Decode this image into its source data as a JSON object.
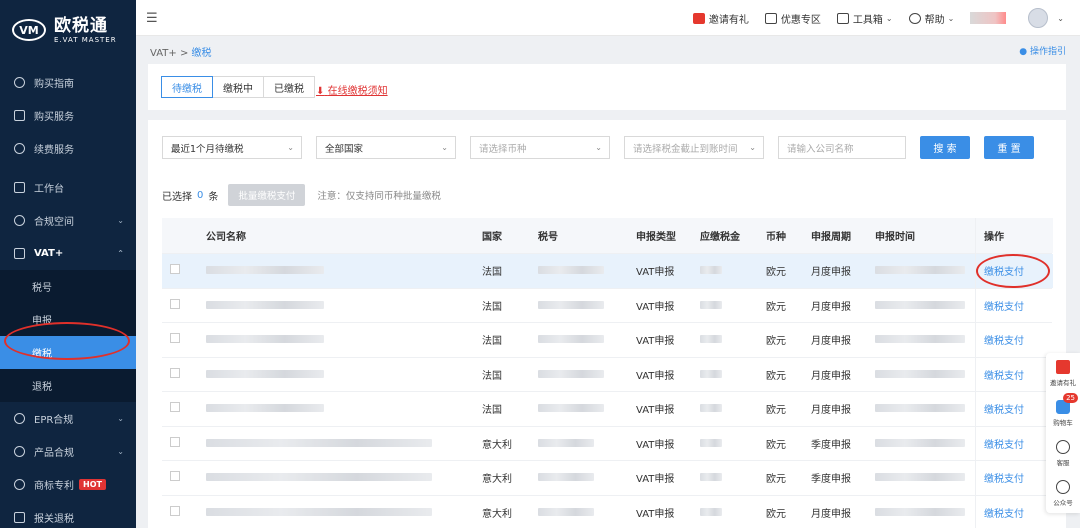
{
  "logo": {
    "cn": "欧税通",
    "en": "E.VAT MASTER",
    "mark": "VM"
  },
  "sidebar": {
    "items": [
      {
        "label": "购买指南",
        "icon": "compass-icon"
      },
      {
        "label": "购买服务",
        "icon": "bag-icon"
      },
      {
        "label": "续费服务",
        "icon": "refresh-icon"
      },
      {
        "label": "工作台",
        "icon": "dashboard-icon"
      },
      {
        "label": "合规空间",
        "icon": "gear-icon"
      },
      {
        "label": "VAT+",
        "icon": "briefcase-icon"
      },
      {
        "label": "EPR合规",
        "icon": "leaf-icon"
      },
      {
        "label": "产品合规",
        "icon": "shield-icon"
      },
      {
        "label": "商标专利",
        "icon": "badge-icon",
        "badge": "HOT"
      },
      {
        "label": "报关退税",
        "icon": "document-icon"
      }
    ],
    "vat_sub": [
      {
        "label": "税号"
      },
      {
        "label": "申报"
      },
      {
        "label": "缴税"
      },
      {
        "label": "退税"
      }
    ]
  },
  "header": {
    "invite": "邀请有礼",
    "coupon": "优惠专区",
    "toolbox": "工具箱",
    "help": "帮助"
  },
  "breadcrumb": {
    "root": "VAT+",
    "sep": ">",
    "current": "缴税"
  },
  "guide_link": "操作指引",
  "tabs": [
    {
      "label": "待缴税"
    },
    {
      "label": "缴税中"
    },
    {
      "label": "已缴税"
    }
  ],
  "notice_link": "在线缴税须知",
  "filters": {
    "period": "最近1个月待缴税",
    "country": "全部国家",
    "currency_ph": "请选择币种",
    "deadline_ph": "请选择税金截止到账时间",
    "company_ph": "请输入公司名称",
    "search": "搜 索",
    "reset": "重 置"
  },
  "selection": {
    "prefix": "已选择",
    "count": "0",
    "suffix": "条",
    "batch_button": "批量缴税支付",
    "note": "注意：仅支持同币种批量缴税"
  },
  "table": {
    "columns": {
      "name": "公司名称",
      "country": "国家",
      "tax_no": "税号",
      "type": "申报类型",
      "amount": "应缴税金",
      "currency": "币种",
      "period": "申报周期",
      "time": "申报时间",
      "op": "操作"
    },
    "rows": [
      {
        "country": "法国",
        "type": "VAT申报",
        "currency": "欧元",
        "period": "月度申报",
        "op": "缴税支付"
      },
      {
        "country": "法国",
        "type": "VAT申报",
        "currency": "欧元",
        "period": "月度申报",
        "op": "缴税支付"
      },
      {
        "country": "法国",
        "type": "VAT申报",
        "currency": "欧元",
        "period": "月度申报",
        "op": "缴税支付"
      },
      {
        "country": "法国",
        "type": "VAT申报",
        "currency": "欧元",
        "period": "月度申报",
        "op": "缴税支付"
      },
      {
        "country": "法国",
        "type": "VAT申报",
        "currency": "欧元",
        "period": "月度申报",
        "op": "缴税支付"
      },
      {
        "country": "意大利",
        "type": "VAT申报",
        "currency": "欧元",
        "period": "季度申报",
        "op": "缴税支付"
      },
      {
        "country": "意大利",
        "type": "VAT申报",
        "currency": "欧元",
        "period": "季度申报",
        "op": "缴税支付"
      },
      {
        "country": "意大利",
        "type": "VAT申报",
        "currency": "欧元",
        "period": "月度申报",
        "op": "缴税支付"
      }
    ]
  },
  "float_bar": {
    "invite": "邀请有礼",
    "cart": "购物车",
    "cart_count": "25",
    "service": "客服",
    "official": "公众号"
  }
}
